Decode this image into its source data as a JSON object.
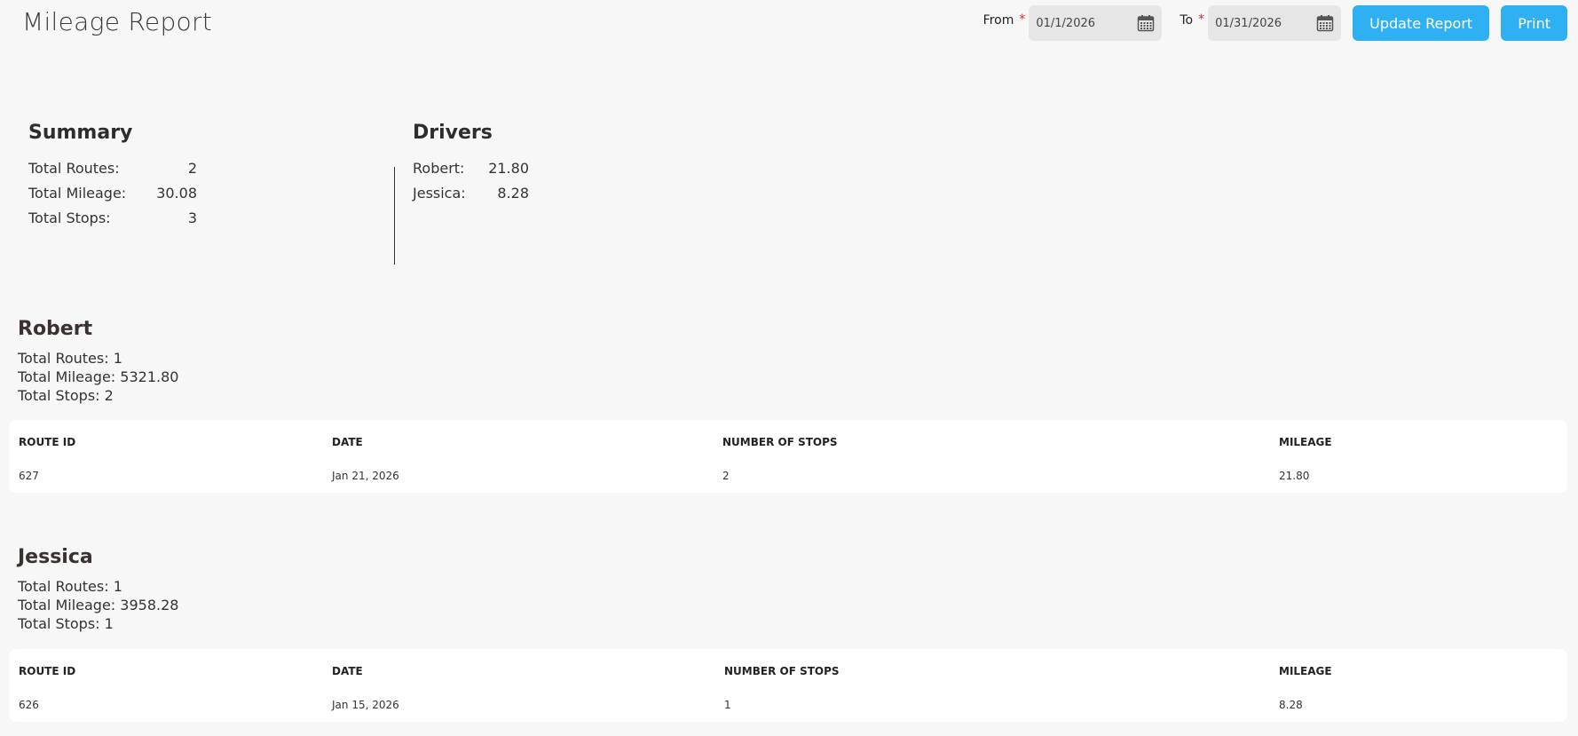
{
  "header": {
    "title": "Mileage Report",
    "from_label": "From",
    "to_label": "To",
    "required_mark": "*",
    "from_value": "01/1/2026",
    "to_value": "01/31/2026",
    "update_label": "Update Report",
    "print_label": "Print"
  },
  "summary": {
    "heading": "Summary",
    "rows": [
      {
        "label": "Total Routes:",
        "value": "2"
      },
      {
        "label": "Total Mileage:",
        "value": "30.08"
      },
      {
        "label": "Total Stops:",
        "value": "3"
      }
    ]
  },
  "drivers": {
    "heading": "Drivers",
    "rows": [
      {
        "label": "Robert:",
        "value": "21.80"
      },
      {
        "label": "Jessica:",
        "value": "8.28"
      }
    ]
  },
  "driver_sections": [
    {
      "name": "Robert",
      "total_routes": "Total Routes: 1",
      "total_mileage": "Total Mileage: 5321.80",
      "total_stops": "Total Stops: 2",
      "columns": [
        "ROUTE ID",
        "DATE",
        "NUMBER OF STOPS",
        "MILEAGE"
      ],
      "rows": [
        [
          "627",
          "Jan 21, 2026",
          "2",
          "21.80"
        ]
      ]
    },
    {
      "name": "Jessica",
      "total_routes": "Total Routes: 1",
      "total_mileage": "Total Mileage: 3958.28",
      "total_stops": "Total Stops: 1",
      "columns": [
        "ROUTE ID",
        "DATE",
        "NUMBER OF STOPS",
        "MILEAGE"
      ],
      "rows": [
        [
          "626",
          "Jan 15, 2026",
          "1",
          "8.28"
        ]
      ]
    }
  ],
  "colors": {
    "accent": "#2fb0f3",
    "required": "#e02424",
    "background": "#f7f7f7",
    "card": "#ffffff"
  },
  "icons": {
    "date_picker": "calendar-icon"
  }
}
